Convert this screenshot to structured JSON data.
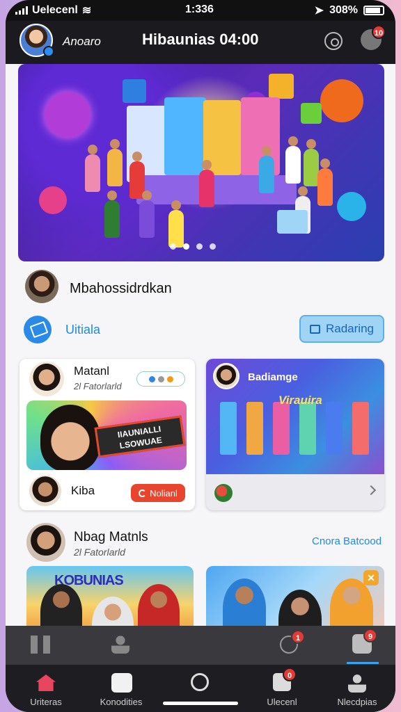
{
  "status_bar": {
    "carrier": "Uelecenl",
    "time": "1:336",
    "battery": "308%"
  },
  "header": {
    "username": "Anoaro",
    "title": "Hibaunias 04:00",
    "notification_count": "10"
  },
  "hero": {
    "slide_count": 4,
    "active_slide": 2
  },
  "creator": {
    "name": "Mbahossidrdkan"
  },
  "chip": {
    "label": "Uitiala",
    "button_label": "Radaring"
  },
  "card1": {
    "name": "Matanl",
    "subtitle": "2l Fatorlarld",
    "banner_text": "IIAUNIALLI  LSOWUAE",
    "footer_name": "Kiba",
    "footer_button": "Nolianl"
  },
  "card2": {
    "name": "Badiamge",
    "overlay_text": "Virauira"
  },
  "section": {
    "title": "Nbag Matnls",
    "subtitle": "2l Fatorlarld",
    "link": "Cnora Batcood"
  },
  "thumb_a": {
    "text": "KOBUNIAS"
  },
  "nav": {
    "top_badges": [
      "1",
      "9"
    ],
    "items": [
      "Uriteras",
      "Konodities",
      "",
      "Ulecenl",
      "Nlecdpias"
    ],
    "bottom_badge": "0"
  },
  "colors": {
    "accent": "#1e88e5",
    "danger": "#e53935",
    "nav_bg": "#1e1e22",
    "home_active": "#e8455f"
  },
  "icons": [
    "signal-icon",
    "wifi-icon",
    "battery-icon",
    "search-icon",
    "bell-icon",
    "home-icon",
    "controller-icon",
    "search-icon",
    "camera-icon",
    "profile-icon"
  ]
}
